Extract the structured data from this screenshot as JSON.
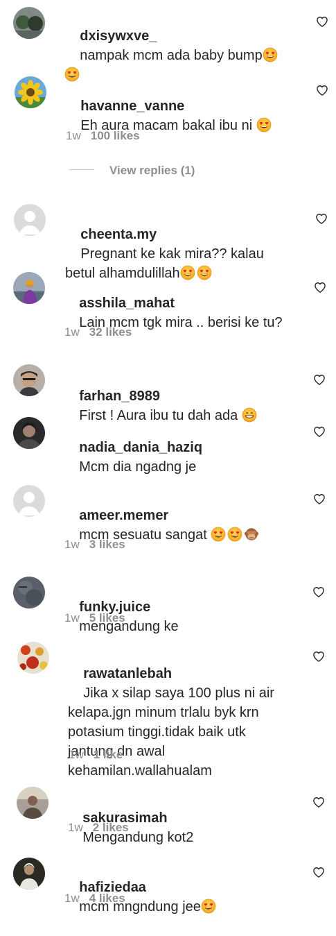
{
  "comments": [
    {
      "username": "dxisywxve_",
      "text": "nampak mcm ada baby bump",
      "emojis": [
        "heart-eyes-emoji",
        "heart-eyes-emoji"
      ],
      "time": "",
      "likes": ""
    },
    {
      "username": "havanne_vanne",
      "text": "Eh aura macam bakal ibu ni",
      "emojis": [
        "heart-eyes-emoji"
      ],
      "time": "1w",
      "likes": "100 likes",
      "view_replies": "View replies (1)"
    },
    {
      "username": "cheenta.my",
      "text": "Pregnant ke kak mira?? kalau betul alhamdulillah",
      "emojis": [
        "heart-eyes-emoji",
        "heart-eyes-emoji"
      ],
      "time": "",
      "likes": ""
    },
    {
      "username": "asshila_mahat",
      "text": "Lain mcm tgk mira .. berisi ke tu?",
      "emojis": [],
      "time": "1w",
      "likes": "32 likes"
    },
    {
      "username": "farhan_8989",
      "text": "First ! Aura ibu tu dah ada",
      "emojis": [
        "grinning-emoji"
      ],
      "time": "",
      "likes": ""
    },
    {
      "username": "nadia_dania_haziq",
      "text": "Mcm dia ngadng je",
      "emojis": [],
      "time": "",
      "likes": ""
    },
    {
      "username": "ameer.memer",
      "text": "mcm sesuatu sangat",
      "emojis": [
        "heart-eyes-emoji",
        "heart-eyes-emoji",
        "see-no-evil-monkey-emoji"
      ],
      "time": "1w",
      "likes": "3 likes"
    },
    {
      "username": "funky.juice",
      "text": "mengandung ke",
      "emojis": [],
      "time": "1w",
      "likes": "5 likes"
    },
    {
      "username": "rawatanlebah",
      "text": "Jika x silap saya 100 plus ni air kelapa.jgn minum trlalu byk krn potasium tinggi.tidak baik utk jantung dn awal kehamilan.wallahualam",
      "emojis": [],
      "time": "1w",
      "likes": "1 like"
    },
    {
      "username": "sakurasimah",
      "text": "Mengandung kot2",
      "emojis": [],
      "time": "1w",
      "likes": "2 likes"
    },
    {
      "username": "hafiziedaa",
      "text": "mcm mngndung jee",
      "emojis": [
        "heart-eyes-emoji"
      ],
      "time": "1w",
      "likes": "4 likes"
    }
  ],
  "icons": {
    "like": "heart-outline-icon"
  },
  "colors": {
    "text": "#262626",
    "secondary": "#8e8e8e"
  }
}
